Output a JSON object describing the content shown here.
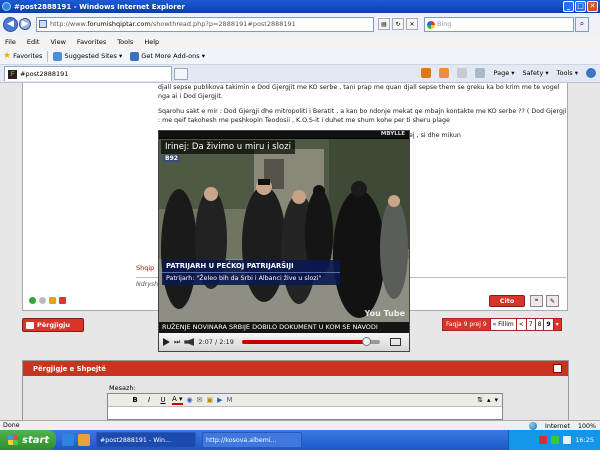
{
  "window": {
    "title": "#post2888191 - Windows Internet Explorer",
    "min": "_",
    "max": "□",
    "close": "✕"
  },
  "address": {
    "prefix": "http://www.",
    "domain": "forumishqiptar.com",
    "path": "/showthread.php?p=2888191#post2888191",
    "search_placeholder": "Bing"
  },
  "menu": [
    "File",
    "Edit",
    "View",
    "Favorites",
    "Tools",
    "Help"
  ],
  "favorites": {
    "label": "Favorites",
    "items": [
      "Suggested Sites ▾",
      "Get More Add-ons ▾"
    ]
  },
  "tab": {
    "label": "#post2888191"
  },
  "commands": [
    "Page ▾",
    "Safety ▾",
    "Tools ▾"
  ],
  "post": {
    "paragraphs": [
      "djall sepse publikova takimin e Dod Gjergjit me KO serbe , tani prap me quan djall sepse them se greku ka bo krim me te vogel nga ai i Dod Gjergjit.",
      "Sqarohu sakt e mir : Dod Gjergji dhe mitropoliti i Beratit , a kan bo ndonje mekat qe mbajn kontakte me KO serbe ?? ( Dod Gjergji : me qeif takohesh me peshkopin Teodosii , K.O.S-it i duhet me shum kohe per ti sheru plage",
      "Ne mi                                                                             e Beratit , patriarhun Irinej , si dhe mikun"
    ],
    "signature": "Shqip",
    "signature2": "Ndrysh",
    "cito": "Cito"
  },
  "reply_button": "Përgjigju",
  "pager": {
    "label": "Faqja 9 prej 9",
    "first": "« Fillim",
    "prev": "<",
    "pages": [
      "7",
      "8",
      "9"
    ],
    "current": "9"
  },
  "quick_reply": {
    "title": "Përgjigje e Shpejtë",
    "message_label": "Mesazh:",
    "tools": [
      "B",
      "I",
      "U",
      "A ▾"
    ]
  },
  "video": {
    "header": "MBYLLE",
    "title": "Irinej: Da živimo u miru i slozi",
    "channel": "B92",
    "caption_line1": "PATRIJARH U PEĆKOJ PATRIJARŠIJI",
    "caption_line2": "Patrijarh: \"Želeo bih da Srbi i Albanci žive u slozi\"",
    "ticker": "RUŽENJE NOVINARA SRBIJE DOBILO DOKUMENT U KOM SE NAVODI",
    "watermark": "You Tube",
    "time": "2:07 / 2:19",
    "progress": 0.91
  },
  "status": {
    "left": "Done",
    "zone": "Internet",
    "zoom": "100%"
  },
  "taskbar": {
    "start": "start",
    "items": [
      "#post2888191 - Win...",
      "http://kosova.albemi..."
    ],
    "clock": "16:25"
  }
}
